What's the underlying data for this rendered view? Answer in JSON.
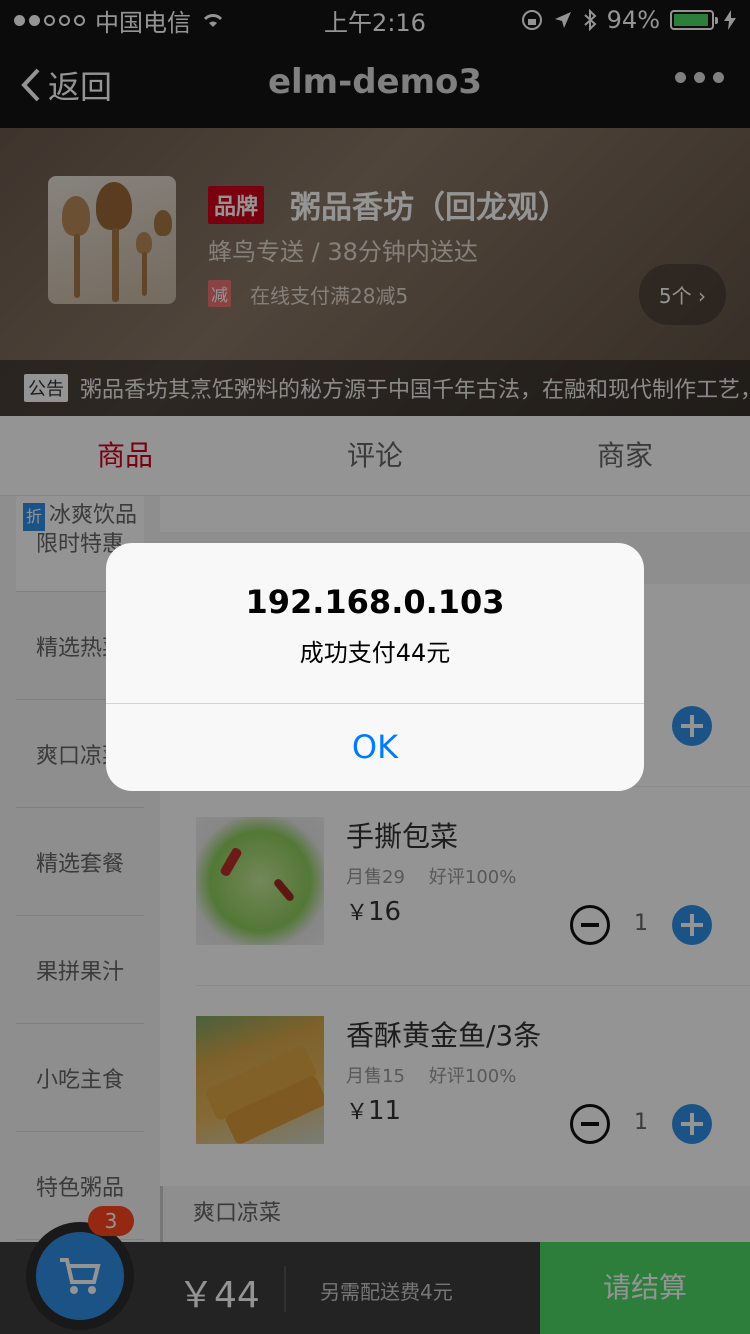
{
  "status_bar": {
    "carrier": "中国电信",
    "time": "上午2:16",
    "battery": "94%",
    "battery_level": 0.94
  },
  "nav": {
    "back_label": "返回",
    "title": "elm-demo3"
  },
  "shop": {
    "brand_badge": "品牌",
    "name": "粥品香坊（回龙观）",
    "delivery": "蜂鸟专送 / 38分钟内送达",
    "promo_icon": "减",
    "promo_text": "在线支付满28减5",
    "promo_count": "5个",
    "notice_tag": "公告",
    "notice_text": "粥品香坊其烹饪粥料的秘方源于中国千年古法，在融和现代制作工艺，由世界"
  },
  "tabs": [
    {
      "label": "商品",
      "active": true
    },
    {
      "label": "评论",
      "active": false
    },
    {
      "label": "商家",
      "active": false
    }
  ],
  "categories": [
    {
      "label": "冰爽饮品限时特惠",
      "badge": "折"
    },
    {
      "label": "精选热菜"
    },
    {
      "label": "爽口凉菜"
    },
    {
      "label": "精选套餐"
    },
    {
      "label": "果拼果汁"
    },
    {
      "label": "小吃主食"
    },
    {
      "label": "特色粥品"
    }
  ],
  "foods": [
    {
      "name": "手撕包菜",
      "sales": "月售29",
      "rating": "好评100%",
      "price": "16",
      "qty": "1"
    },
    {
      "name": "香酥黄金鱼/3条",
      "sales": "月售15",
      "rating": "好评100%",
      "price": "11",
      "qty": "1"
    }
  ],
  "section_footer": "爽口凉菜",
  "cart": {
    "count": "3",
    "total": "￥44",
    "fee": "另需配送费4元",
    "checkout": "请结算"
  },
  "alert": {
    "title": "192.168.0.103",
    "message": "成功支付44元",
    "ok": "OK"
  },
  "colors": {
    "accent_red": "#d0021b",
    "accent_blue": "#3190e8",
    "checkout_green": "#4cd964",
    "ios_blue": "#007aff"
  }
}
